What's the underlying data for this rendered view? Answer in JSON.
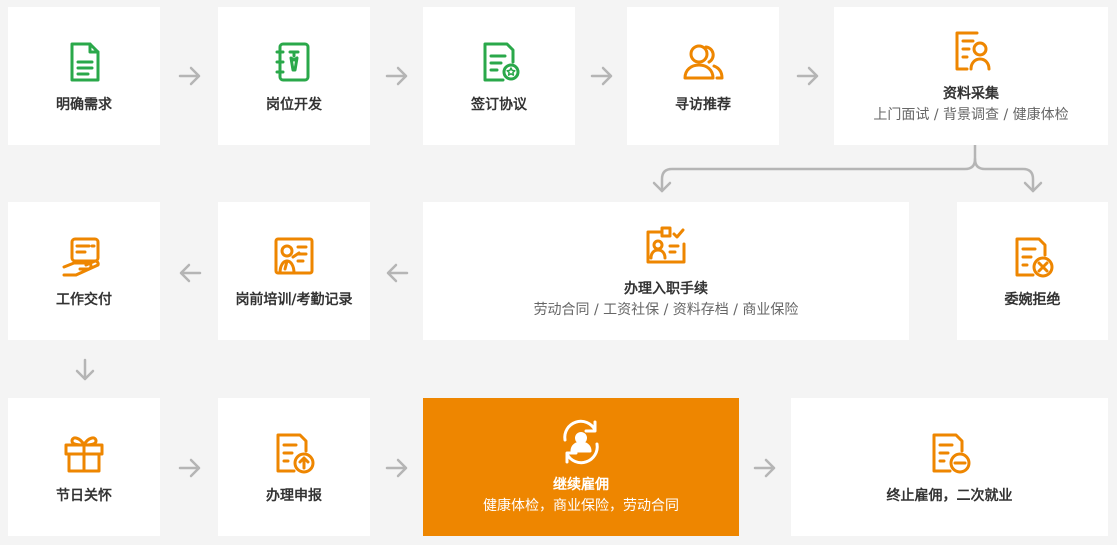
{
  "colors": {
    "green": "#2aa84a",
    "orange": "#ee8600",
    "arrow": "#b5b5b5",
    "bg": "#f4f4f4"
  },
  "steps": {
    "s1": {
      "title": "明确需求",
      "icon": "document-icon"
    },
    "s2": {
      "title": "岗位开发",
      "icon": "job-card-icon"
    },
    "s3": {
      "title": "签订协议",
      "icon": "signed-document-icon"
    },
    "s4": {
      "title": "寻访推荐",
      "icon": "people-icon"
    },
    "s5": {
      "title": "资料采集",
      "sub": "上门面试 / 背景调查 / 健康体检",
      "icon": "profile-document-icon"
    },
    "s6": {
      "title": "办理入职手续",
      "sub": "劳动合同 / 工资社保 / 资料存档 / 商业保险",
      "icon": "id-badge-icon"
    },
    "s7": {
      "title": "委婉拒绝",
      "icon": "reject-document-icon"
    },
    "s8": {
      "title": "岗前培训/考勤记录",
      "icon": "training-board-icon"
    },
    "s9": {
      "title": "工作交付",
      "icon": "hand-document-icon"
    },
    "s10": {
      "title": "节日关怀",
      "icon": "gift-icon"
    },
    "s11": {
      "title": "办理申报",
      "icon": "upload-document-icon"
    },
    "s12": {
      "title": "继续雇佣",
      "sub": "健康体检，商业保险，劳动合同",
      "icon": "renew-user-icon"
    },
    "s13": {
      "title": "终止雇佣，二次就业",
      "icon": "minus-document-icon"
    }
  }
}
